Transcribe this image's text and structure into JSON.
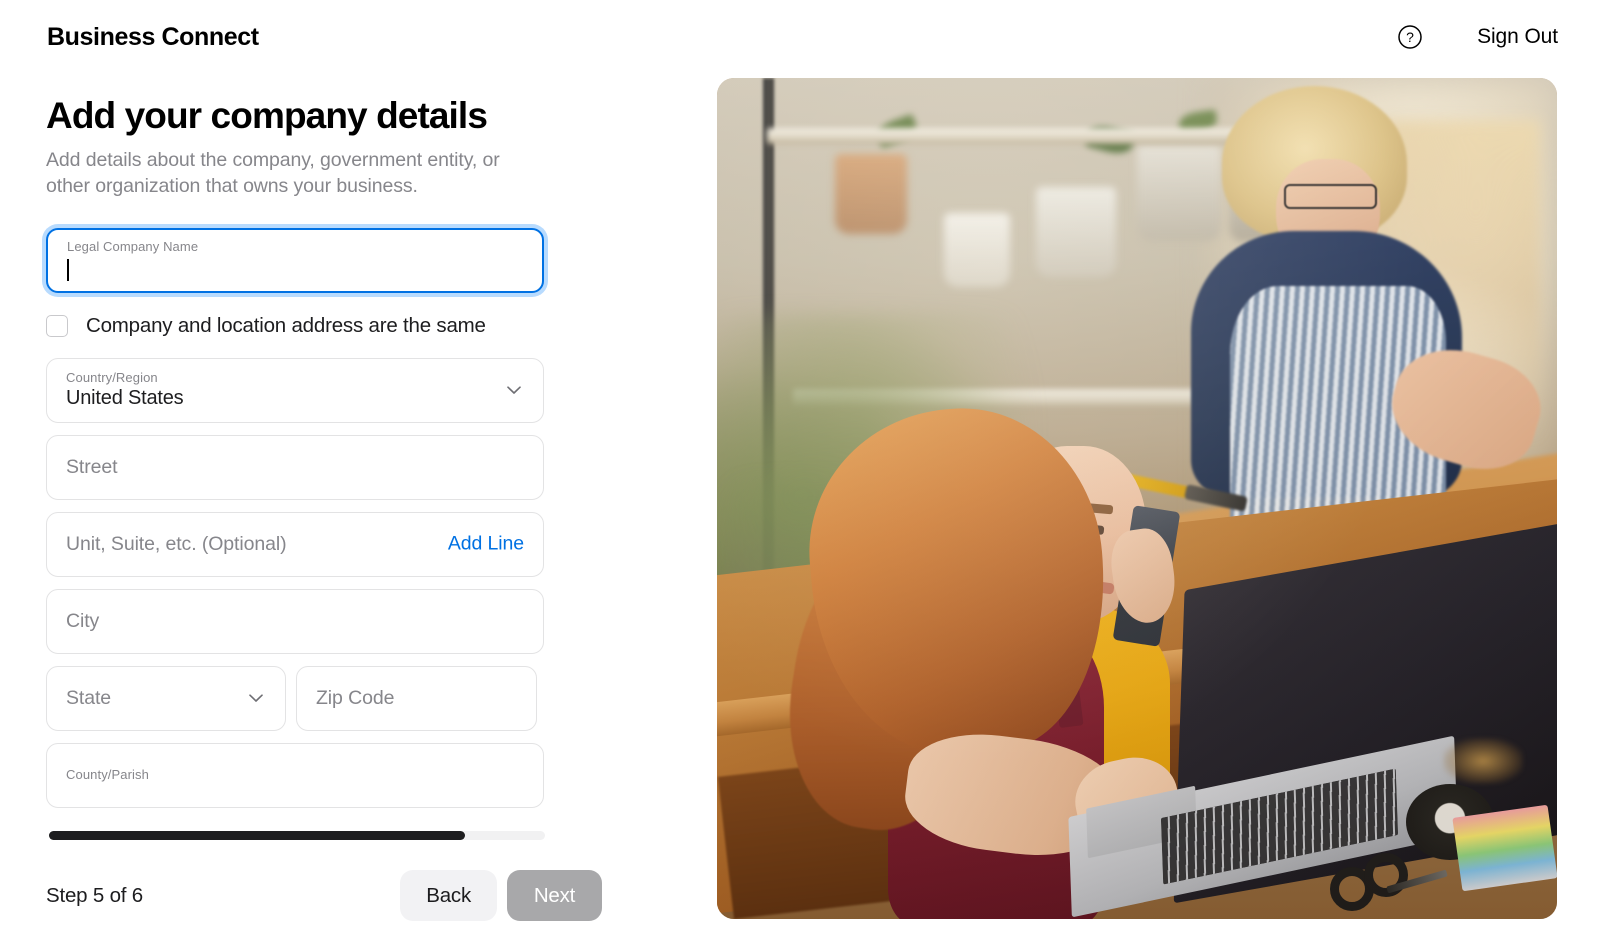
{
  "header": {
    "apple_glyph": "",
    "brand": "Business Connect",
    "help_icon": "question-mark-circle-icon",
    "sign_out": "Sign Out"
  },
  "form": {
    "title": "Add your company details",
    "subtitle": "Add details about the company, government entity, or other organization that owns your business.",
    "legal_company_name": {
      "label": "Legal Company Name",
      "value": ""
    },
    "same_address_checkbox": {
      "label": "Company and location address are the same",
      "checked": false
    },
    "country_region": {
      "label": "Country/Region",
      "value": "United States",
      "chevron": "chevron-down-icon"
    },
    "street": {
      "placeholder": "Street",
      "value": ""
    },
    "unit": {
      "placeholder": "Unit, Suite, etc. (Optional)",
      "value": "",
      "add_line_label": "Add Line"
    },
    "city": {
      "placeholder": "City",
      "value": ""
    },
    "state": {
      "placeholder": "State",
      "value": "",
      "chevron": "chevron-down-icon"
    },
    "zip": {
      "placeholder": "Zip Code",
      "value": ""
    },
    "county": {
      "placeholder": "County/Parish",
      "value": ""
    }
  },
  "footer": {
    "step_text": "Step 5 of 6",
    "back_label": "Back",
    "next_label": "Next"
  },
  "colors": {
    "accent_blue": "#0071e3",
    "focus_border": "#0071e3",
    "placeholder_grey": "#86868b",
    "field_border": "#e3e3e4",
    "back_button_bg": "#f2f2f4",
    "next_button_bg": "#a8a8aa",
    "scrollbar_thumb": "#1d1d1f"
  },
  "hero_image": {
    "alt": "Two florists working in a flower shop, one on the phone using a laptop"
  }
}
